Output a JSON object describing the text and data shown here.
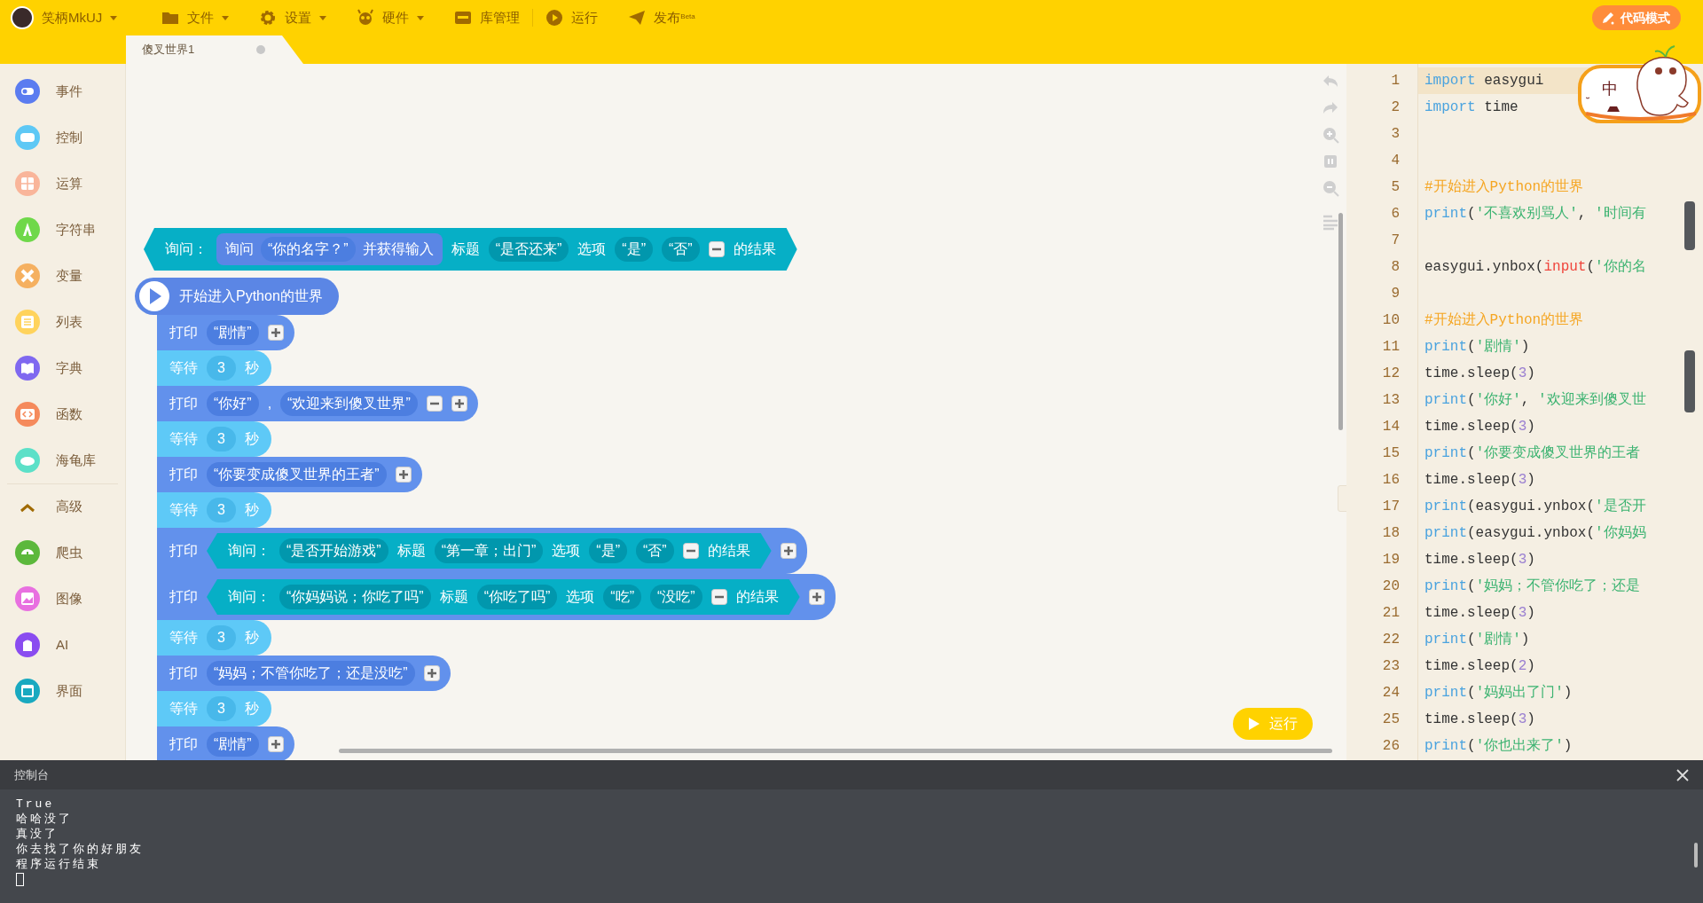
{
  "menu": {
    "user": {
      "label": "笑柄MkUJ",
      "dropdown": true
    },
    "items": [
      {
        "label": "文件",
        "dropdown": true
      },
      {
        "label": "设置",
        "dropdown": true
      },
      {
        "label": "硬件",
        "dropdown": true
      },
      {
        "label": "库管理",
        "dropdown": false
      },
      {
        "label": "运行",
        "dropdown": false
      },
      {
        "label": "发布$^{Beta}$",
        "dropdown": false
      }
    ],
    "mode_button": "代码模式"
  },
  "tabs": [
    {
      "label": "傻叉世界1",
      "selected": true
    }
  ],
  "sidebar": {
    "items": [
      {
        "kind": "category",
        "label": "事件",
        "color": "#5b7cf0"
      },
      {
        "kind": "category",
        "label": "控制",
        "color": "#5ec8f5"
      },
      {
        "kind": "category",
        "label": "运算",
        "color": "#f9b59a"
      },
      {
        "kind": "category",
        "label": "字符串",
        "color": "#6fd84a"
      },
      {
        "kind": "category",
        "label": "变量",
        "color": "#f5b060"
      },
      {
        "kind": "category",
        "label": "列表",
        "color": "#ffd35c"
      },
      {
        "kind": "category",
        "label": "字典",
        "color": "#7f68f0"
      },
      {
        "kind": "category",
        "label": "函数",
        "color": "#f58a5c"
      },
      {
        "kind": "category",
        "label": "海龟库",
        "color": "#5ce0c8"
      },
      {
        "kind": "section",
        "label": "高级",
        "expanded": true
      },
      {
        "kind": "category",
        "label": "爬虫",
        "color": "#5cb83c"
      },
      {
        "kind": "category",
        "label": "图像",
        "color": "#e870e0"
      },
      {
        "kind": "category",
        "label": "AI",
        "color": "#8a4cf0"
      },
      {
        "kind": "category",
        "label": "界面",
        "color": "#19a9c0"
      }
    ]
  },
  "workspace": {
    "blocks": [
      {
        "kind": "ask",
        "parts": [
          {
            "kind": "label",
            "text": "询问："
          },
          {
            "kind": "call",
            "parts": [
              {
                "kind": "label",
                "text": "询问"
              },
              {
                "kind": "string",
                "text": "“你的名字？”"
              },
              {
                "kind": "label",
                "text": "并获得输入"
              }
            ]
          },
          {
            "kind": "label",
            "text": "标题"
          },
          {
            "kind": "string",
            "text": "“是否还来”"
          },
          {
            "kind": "label",
            "text": "选项"
          },
          {
            "kind": "string",
            "text": "“是”"
          },
          {
            "kind": "string",
            "text": "“否”"
          },
          {
            "kind": "minus"
          },
          {
            "kind": "label",
            "text": "的结果"
          }
        ]
      },
      {
        "kind": "hat",
        "parts": [
          {
            "kind": "label",
            "text": "开始进入Python的世界"
          }
        ]
      },
      {
        "kind": "print",
        "parts": [
          {
            "kind": "label",
            "text": "打印"
          },
          {
            "kind": "string",
            "text": "“剧情”"
          },
          {
            "kind": "plus"
          }
        ]
      },
      {
        "kind": "wait",
        "parts": [
          {
            "kind": "label",
            "text": "等待"
          },
          {
            "kind": "number",
            "text": "3"
          },
          {
            "kind": "label",
            "text": "秒"
          }
        ]
      },
      {
        "kind": "print",
        "parts": [
          {
            "kind": "label",
            "text": "打印"
          },
          {
            "kind": "string",
            "text": "“你好”"
          },
          {
            "kind": "label",
            "text": ","
          },
          {
            "kind": "string",
            "text": "“欢迎来到傻叉世界”"
          },
          {
            "kind": "minus"
          },
          {
            "kind": "plus"
          }
        ]
      },
      {
        "kind": "wait",
        "parts": [
          {
            "kind": "label",
            "text": "等待"
          },
          {
            "kind": "number",
            "text": "3"
          },
          {
            "kind": "label",
            "text": "秒"
          }
        ]
      },
      {
        "kind": "print",
        "parts": [
          {
            "kind": "label",
            "text": "打印"
          },
          {
            "kind": "string",
            "text": "“你要变成傻叉世界的王者”"
          },
          {
            "kind": "plus"
          }
        ]
      },
      {
        "kind": "wait",
        "parts": [
          {
            "kind": "label",
            "text": "等待"
          },
          {
            "kind": "number",
            "text": "3"
          },
          {
            "kind": "label",
            "text": "秒"
          }
        ]
      },
      {
        "kind": "print",
        "parts": [
          {
            "kind": "label",
            "text": "打印"
          },
          {
            "kind": "ask",
            "parts": [
              {
                "kind": "label",
                "text": "询问："
              },
              {
                "kind": "string",
                "text": "“是否开始游戏”"
              },
              {
                "kind": "label",
                "text": "标题"
              },
              {
                "kind": "string",
                "text": "“第一章；出门”"
              },
              {
                "kind": "label",
                "text": "选项"
              },
              {
                "kind": "string",
                "text": "“是”"
              },
              {
                "kind": "string",
                "text": "“否”"
              },
              {
                "kind": "minus"
              },
              {
                "kind": "label",
                "text": "的结果"
              }
            ]
          },
          {
            "kind": "plus"
          }
        ]
      },
      {
        "kind": "print",
        "parts": [
          {
            "kind": "label",
            "text": "打印"
          },
          {
            "kind": "ask",
            "parts": [
              {
                "kind": "label",
                "text": "询问："
              },
              {
                "kind": "string",
                "text": "“你妈妈说；你吃了吗”"
              },
              {
                "kind": "label",
                "text": "标题"
              },
              {
                "kind": "string",
                "text": "“你吃了吗”"
              },
              {
                "kind": "label",
                "text": "选项"
              },
              {
                "kind": "string",
                "text": "“吃”"
              },
              {
                "kind": "string",
                "text": "“没吃”"
              },
              {
                "kind": "minus"
              },
              {
                "kind": "label",
                "text": "的结果"
              }
            ]
          },
          {
            "kind": "plus"
          }
        ]
      },
      {
        "kind": "wait",
        "parts": [
          {
            "kind": "label",
            "text": "等待"
          },
          {
            "kind": "number",
            "text": "3"
          },
          {
            "kind": "label",
            "text": "秒"
          }
        ]
      },
      {
        "kind": "print",
        "parts": [
          {
            "kind": "label",
            "text": "打印"
          },
          {
            "kind": "string",
            "text": "“妈妈；不管你吃了；还是没吃”"
          },
          {
            "kind": "plus"
          }
        ]
      },
      {
        "kind": "wait",
        "parts": [
          {
            "kind": "label",
            "text": "等待"
          },
          {
            "kind": "number",
            "text": "3"
          },
          {
            "kind": "label",
            "text": "秒"
          }
        ]
      },
      {
        "kind": "print",
        "parts": [
          {
            "kind": "label",
            "text": "打印"
          },
          {
            "kind": "string",
            "text": "“剧情”"
          },
          {
            "kind": "plus"
          }
        ]
      }
    ],
    "run_button": "运行"
  },
  "code_editor": {
    "lines": [
      {
        "number": "1",
        "current": true,
        "tokens": [
          {
            "kind": "keyword",
            "text": "import"
          },
          {
            "kind": "plain",
            "text": " easygui"
          }
        ]
      },
      {
        "number": "2",
        "current": false,
        "tokens": [
          {
            "kind": "keyword",
            "text": "import"
          },
          {
            "kind": "plain",
            "text": " time"
          }
        ]
      },
      {
        "number": "3",
        "current": false
      },
      {
        "number": "4",
        "current": false
      },
      {
        "number": "5",
        "current": false,
        "tokens": [
          {
            "kind": "comment",
            "text": "#开始进入Python的世界"
          }
        ]
      },
      {
        "number": "6",
        "current": false,
        "tokens": [
          {
            "kind": "keyword",
            "text": "print"
          },
          {
            "kind": "plain",
            "text": "("
          },
          {
            "kind": "string",
            "text": "'不喜欢别骂人'"
          },
          {
            "kind": "plain",
            "text": ", "
          },
          {
            "kind": "string",
            "text": "'时间有"
          }
        ]
      },
      {
        "number": "7",
        "current": false
      },
      {
        "number": "8",
        "current": false,
        "tokens": [
          {
            "kind": "plain",
            "text": "easygui.ynbox("
          },
          {
            "kind": "builtin",
            "text": "input"
          },
          {
            "kind": "plain",
            "text": "("
          },
          {
            "kind": "string",
            "text": "'你的名"
          }
        ]
      },
      {
        "number": "9",
        "current": false
      },
      {
        "number": "10",
        "current": false,
        "tokens": [
          {
            "kind": "comment",
            "text": "#开始进入Python的世界"
          }
        ]
      },
      {
        "number": "11",
        "current": false,
        "tokens": [
          {
            "kind": "keyword",
            "text": "print"
          },
          {
            "kind": "plain",
            "text": "("
          },
          {
            "kind": "string",
            "text": "'剧情'"
          },
          {
            "kind": "plain",
            "text": ")"
          }
        ]
      },
      {
        "number": "12",
        "current": false,
        "tokens": [
          {
            "kind": "plain",
            "text": "time.sleep("
          },
          {
            "kind": "number",
            "text": "3"
          },
          {
            "kind": "plain",
            "text": ")"
          }
        ]
      },
      {
        "number": "13",
        "current": false,
        "tokens": [
          {
            "kind": "keyword",
            "text": "print"
          },
          {
            "kind": "plain",
            "text": "("
          },
          {
            "kind": "string",
            "text": "'你好'"
          },
          {
            "kind": "plain",
            "text": ", "
          },
          {
            "kind": "string",
            "text": "'欢迎来到傻叉世"
          }
        ]
      },
      {
        "number": "14",
        "current": false,
        "tokens": [
          {
            "kind": "plain",
            "text": "time.sleep("
          },
          {
            "kind": "number",
            "text": "3"
          },
          {
            "kind": "plain",
            "text": ")"
          }
        ]
      },
      {
        "number": "15",
        "current": false,
        "tokens": [
          {
            "kind": "keyword",
            "text": "print"
          },
          {
            "kind": "plain",
            "text": "("
          },
          {
            "kind": "string",
            "text": "'你要变成傻叉世界的王者"
          }
        ]
      },
      {
        "number": "16",
        "current": false,
        "tokens": [
          {
            "kind": "plain",
            "text": "time.sleep("
          },
          {
            "kind": "number",
            "text": "3"
          },
          {
            "kind": "plain",
            "text": ")"
          }
        ]
      },
      {
        "number": "17",
        "current": false,
        "tokens": [
          {
            "kind": "keyword",
            "text": "print"
          },
          {
            "kind": "plain",
            "text": "(easygui.ynbox("
          },
          {
            "kind": "string",
            "text": "'是否开"
          }
        ]
      },
      {
        "number": "18",
        "current": false,
        "tokens": [
          {
            "kind": "keyword",
            "text": "print"
          },
          {
            "kind": "plain",
            "text": "(easygui.ynbox("
          },
          {
            "kind": "string",
            "text": "'你妈妈"
          }
        ]
      },
      {
        "number": "19",
        "current": false,
        "tokens": [
          {
            "kind": "plain",
            "text": "time.sleep("
          },
          {
            "kind": "number",
            "text": "3"
          },
          {
            "kind": "plain",
            "text": ")"
          }
        ]
      },
      {
        "number": "20",
        "current": false,
        "tokens": [
          {
            "kind": "keyword",
            "text": "print"
          },
          {
            "kind": "plain",
            "text": "("
          },
          {
            "kind": "string",
            "text": "'妈妈；不管你吃了；还是"
          }
        ]
      },
      {
        "number": "21",
        "current": false,
        "tokens": [
          {
            "kind": "plain",
            "text": "time.sleep("
          },
          {
            "kind": "number",
            "text": "3"
          },
          {
            "kind": "plain",
            "text": ")"
          }
        ]
      },
      {
        "number": "22",
        "current": false,
        "tokens": [
          {
            "kind": "keyword",
            "text": "print"
          },
          {
            "kind": "plain",
            "text": "("
          },
          {
            "kind": "string",
            "text": "'剧情'"
          },
          {
            "kind": "plain",
            "text": ")"
          }
        ]
      },
      {
        "number": "23",
        "current": false,
        "tokens": [
          {
            "kind": "plain",
            "text": "time.sleep("
          },
          {
            "kind": "number",
            "text": "2"
          },
          {
            "kind": "plain",
            "text": ")"
          }
        ]
      },
      {
        "number": "24",
        "current": false,
        "tokens": [
          {
            "kind": "keyword",
            "text": "print"
          },
          {
            "kind": "plain",
            "text": "("
          },
          {
            "kind": "string",
            "text": "'妈妈出了门'"
          },
          {
            "kind": "plain",
            "text": ")"
          }
        ]
      },
      {
        "number": "25",
        "current": false,
        "tokens": [
          {
            "kind": "plain",
            "text": "time.sleep("
          },
          {
            "kind": "number",
            "text": "3"
          },
          {
            "kind": "plain",
            "text": ")"
          }
        ]
      },
      {
        "number": "26",
        "current": false,
        "tokens": [
          {
            "kind": "keyword",
            "text": "print"
          },
          {
            "kind": "plain",
            "text": "("
          },
          {
            "kind": "string",
            "text": "'你也出来了'"
          },
          {
            "kind": "plain",
            "text": ")"
          }
        ]
      }
    ]
  },
  "mascot": {
    "text": "中"
  },
  "console": {
    "title": "控制台",
    "lines": [
      "True",
      "哈哈没了",
      "真没了",
      "你去找了你的好朋友",
      "程序运行结束"
    ]
  }
}
